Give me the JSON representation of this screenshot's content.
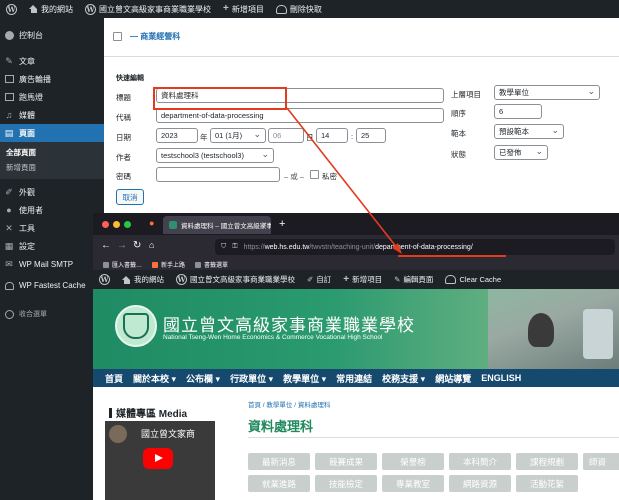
{
  "wp_admin_bar": {
    "site_name": "我的網站",
    "school_name": "國立曾文高級家事商業職業學校",
    "new_item": "新增項目",
    "clear_cache": "刪除快取"
  },
  "sidebar": {
    "items": [
      {
        "label": "控制台",
        "icon": "dashboard-icon"
      },
      {
        "label": "文章",
        "icon": "pin-icon"
      },
      {
        "label": "廣告輪播",
        "icon": "slides-icon"
      },
      {
        "label": "跑馬燈",
        "icon": "marquee-icon"
      },
      {
        "label": "媒體",
        "icon": "media-icon"
      },
      {
        "label": "頁面",
        "icon": "pages-icon"
      }
    ],
    "submenu": [
      "全部頁面",
      "新增頁面"
    ],
    "items2": [
      {
        "label": "外觀",
        "icon": "brush-icon"
      },
      {
        "label": "使用者",
        "icon": "user-icon"
      },
      {
        "label": "工具",
        "icon": "wrench-icon"
      },
      {
        "label": "設定",
        "icon": "settings-icon"
      },
      {
        "label": "WP Mail SMTP",
        "icon": "mail-icon"
      },
      {
        "label": "WP Fastest Cache",
        "icon": "cheetah-icon"
      },
      {
        "label": "收合選單",
        "icon": "collapse-icon"
      }
    ]
  },
  "quick_edit": {
    "row_title": "— 商業經營科",
    "heading": "快速編輯",
    "title_label": "標題",
    "title_value": "資料處理科",
    "slug_label": "代稱",
    "slug_value": "department-of-data-processing",
    "date_label": "日期",
    "year": "2023",
    "year_unit": "年",
    "month": "01 (1月)",
    "day": "06",
    "day_unit": "日",
    "hour": "14",
    "minute_sep": ":",
    "minute": "25",
    "author_label": "作者",
    "author_value": "testschool3 (testschool3)",
    "password_label": "密碼",
    "or_text": "– 或 –",
    "private_label": "私密",
    "parent_label": "上層項目",
    "parent_value": "教學單位",
    "order_label": "順序",
    "order_value": "6",
    "template_label": "範本",
    "template_value": "預設範本",
    "status_label": "狀態",
    "status_value": "已發佈",
    "cancel_label": "取消"
  },
  "browser": {
    "tab_title": "資料處理科 – 國立曾文高級家事商",
    "url_scheme": "https://",
    "url_domain": "web.hs.edu.tw",
    "url_path": "/twvstn/teaching-unit/",
    "url_slug": "department-of-data-processing/",
    "bookmarks": [
      "匯入書籤…",
      "新手上路",
      "書籤選單"
    ],
    "admin_bar": {
      "site_name": "我的網站",
      "school_name": "國立曾文高級家事商業職業學校",
      "customize": "自訂",
      "new_item": "新增項目",
      "edit_page": "編輯頁面",
      "clear_cache": "Clear Cache"
    },
    "school_zh": "國立曾文高級家事商業職業學校",
    "school_en": "National Tseng-Wen Home Economics & Commerce Vocational High School",
    "nav": [
      "首頁",
      "關於本校 ▾",
      "公布欄 ▾",
      "行政單位 ▾",
      "教學單位 ▾",
      "常用連結",
      "校務支援 ▾",
      "網站導覽",
      "ENGLISH"
    ],
    "media_title": "媒體專區 Media",
    "video_title": "國立曾文家商",
    "breadcrumb": "首頁  /  教學單位  /  資料處理科",
    "page_title": "資料處理科",
    "pills_row1": [
      "最新消息",
      "競賽成果",
      "榮譽榜",
      "本科簡介",
      "課程規劃",
      "師資"
    ],
    "pills_row2": [
      "就業進路",
      "技能檢定",
      "專業教室",
      "網路資源",
      "活動花絮"
    ]
  },
  "colors": {
    "admin_dark": "#1d2327",
    "wp_blue": "#2271b1",
    "highlight_red": "#e23b1e",
    "school_green": "#20895e",
    "school_nav": "#16496e"
  }
}
